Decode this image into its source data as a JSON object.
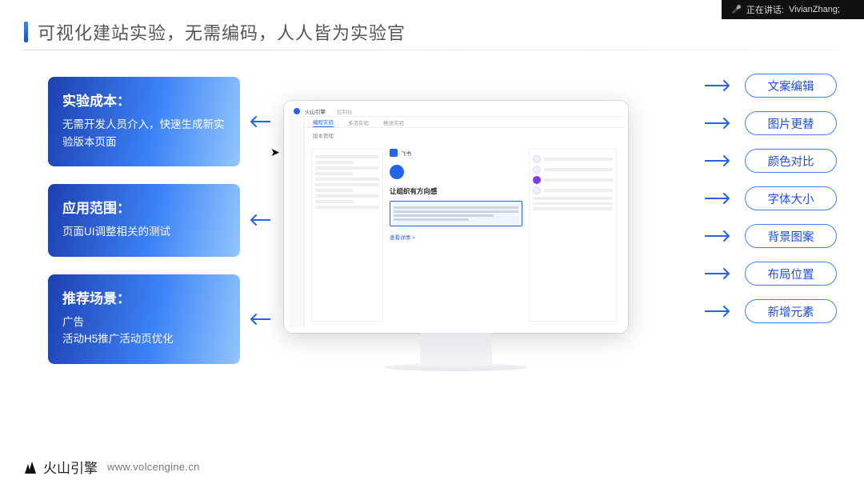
{
  "speaker": {
    "label": "正在讲话:",
    "name": "VivianZhang;"
  },
  "title": "可视化建站实验，无需编码，人人皆为实验官",
  "leftCards": [
    {
      "title": "实验成本：",
      "body": "无需开发人员介入，快速生成新实验版本页面"
    },
    {
      "title": "应用范围：",
      "body": "页面UI调整相关的测试"
    },
    {
      "title": "推荐场景：",
      "body": "广告\n活动H5推广活动页优化"
    }
  ],
  "rightPills": [
    "文案编辑",
    "图片更替",
    "颜色对比",
    "字体大小",
    "背景图案",
    "布局位置",
    "新增元素"
  ],
  "footer": {
    "brand": "火山引擎",
    "url": "www.volcengine.cn"
  },
  "mock": {
    "product": "火山引擎",
    "breadcrumb": "控制台",
    "tabs": [
      "编程实验",
      "多活实验",
      "推送实验",
      ""
    ],
    "sectionLabel": "版本管理",
    "brandSmall": "飞书",
    "headline": "让组织有方向感",
    "link": "查看详情 >"
  },
  "colors": {
    "accent": "#2563eb"
  }
}
